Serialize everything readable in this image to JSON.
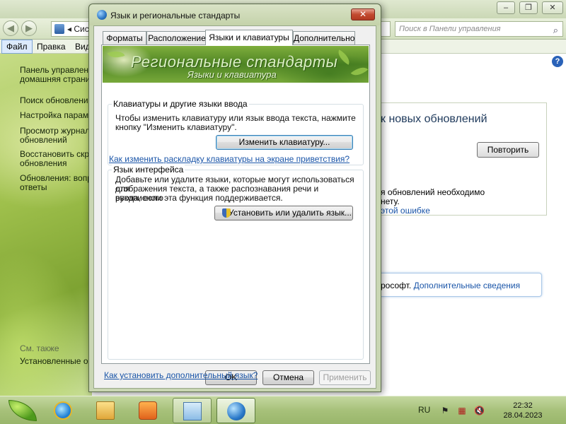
{
  "background_window": {
    "address_text": "Сис",
    "search_placeholder": "Поиск в Панели управления",
    "menu": [
      "Файл",
      "Правка",
      "Вид"
    ],
    "sidebar": [
      "Панель управления —",
      "домашняя страница",
      "Поиск обновлений",
      "Настройка параметров",
      "Просмотр журнала",
      "обновлений",
      "Восстановить скрытые",
      "обновления",
      "Обновления: вопросы и",
      "ответы"
    ],
    "see_also": "См. также",
    "installed_updates": "Установленные обновления",
    "update_heading": "к новых обновлений",
    "retry_button": "Повторить",
    "line1": "я обновлений необходимо",
    "line2": "нету.",
    "line3_link": "этой ошибке",
    "info_text": "рософт.",
    "info_link": "Дополнительные сведения"
  },
  "dialog": {
    "title": "Язык и региональные стандарты",
    "close_label": "✕",
    "tabs": [
      "Форматы",
      "Расположение",
      "Языки и клавиатуры",
      "Дополнительно"
    ],
    "active_tab_index": 2,
    "banner": {
      "title": "Региональные стандарты",
      "subtitle": "Языки и клавиатура"
    },
    "keyboards_group": {
      "title": "Клавиатуры и другие языки ввода",
      "text_line1": "Чтобы изменить клавиатуру или язык ввода текста, нажмите",
      "text_line2": "кнопку \"Изменить клавиатуру\".",
      "button": "Изменить клавиатуру...",
      "link": "Как изменить раскладку клавиатуры на экране приветствия?"
    },
    "display_language_group": {
      "title": "Язык интерфейса",
      "text_line1": "Добавьте или удалите языки, которые могут использоваться для",
      "text_line2": "отображения текста, а также распознавания речи и рукописного",
      "text_line3": "ввода, если эта функция поддерживается.",
      "button": "Установить или удалить язык..."
    },
    "bottom_link": "Как установить дополнительный язык?",
    "buttons": {
      "ok": "OK",
      "cancel": "Отмена",
      "apply": "Применить"
    }
  },
  "taskbar": {
    "language": "RU",
    "time": "22:32",
    "date": "28.04.2023"
  },
  "colors": {
    "theme_green": "#9fc04c",
    "link_blue": "#1a55a8",
    "close_red": "#c24a30"
  }
}
